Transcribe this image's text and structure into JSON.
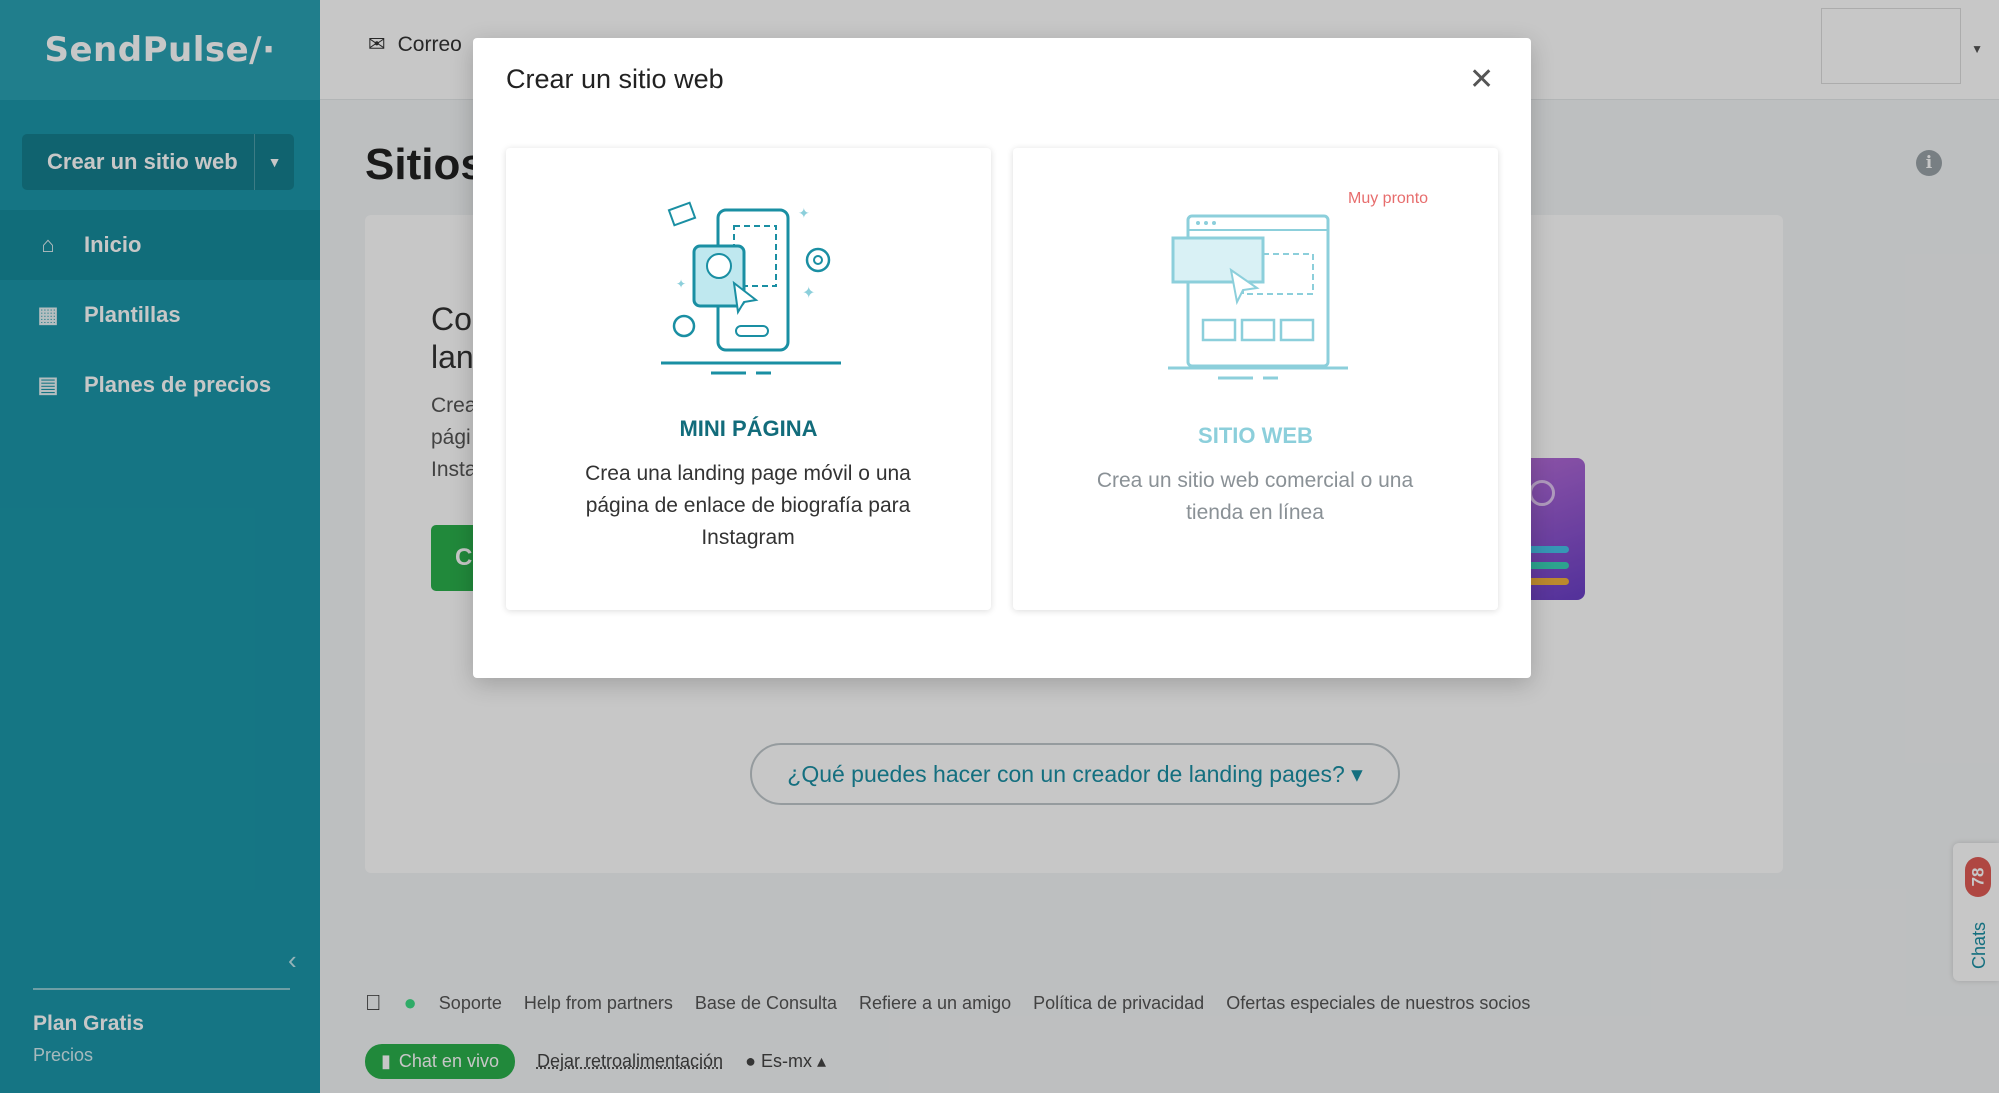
{
  "brand": {
    "logo": "SendPulse∕∙"
  },
  "sidebar": {
    "create_button": "Crear un sitio web",
    "items": [
      {
        "label": "Inicio",
        "icon": "home-icon",
        "active": true
      },
      {
        "label": "Plantillas",
        "icon": "templates-icon",
        "active": false
      },
      {
        "label": "Planes de precios",
        "icon": "pricing-icon",
        "active": false
      }
    ],
    "plan_name": "Plan Gratis",
    "plan_link": "Precios"
  },
  "topbar": {
    "mail_label": "Correo"
  },
  "main": {
    "title": "Sitios",
    "hero_title": "Co lan",
    "hero_text": "Crea pági Insta",
    "hero_button": "C",
    "faq_label": "¿Qué puedes hacer con un creador de landing pages? ▾"
  },
  "footer": {
    "links": [
      "Soporte",
      "Help from partners",
      "Base de Consulta",
      "Refiere a un amigo",
      "Política de privacidad",
      "Ofertas especiales de nuestros socios"
    ],
    "chat_button": "Chat en vivo",
    "feedback": "Dejar retroalimentación",
    "lang": "Es-mx ▴"
  },
  "chats": {
    "label": "Chats",
    "count": "78"
  },
  "modal": {
    "title": "Crear un sitio web",
    "options": [
      {
        "title": "MINI PÁGINA",
        "desc": "Crea una landing page móvil o una página de enlace de biografía para Instagram"
      },
      {
        "title": "SITIO WEB",
        "desc": "Crea un sitio web comercial o una tienda en línea",
        "badge": "Muy pronto"
      }
    ]
  },
  "colors": {
    "sidebar": "#1b97a9",
    "accent": "#1a8fa3",
    "green": "#2bb04c",
    "badge_red": "#e05b55",
    "soon": "#e76d6d"
  }
}
